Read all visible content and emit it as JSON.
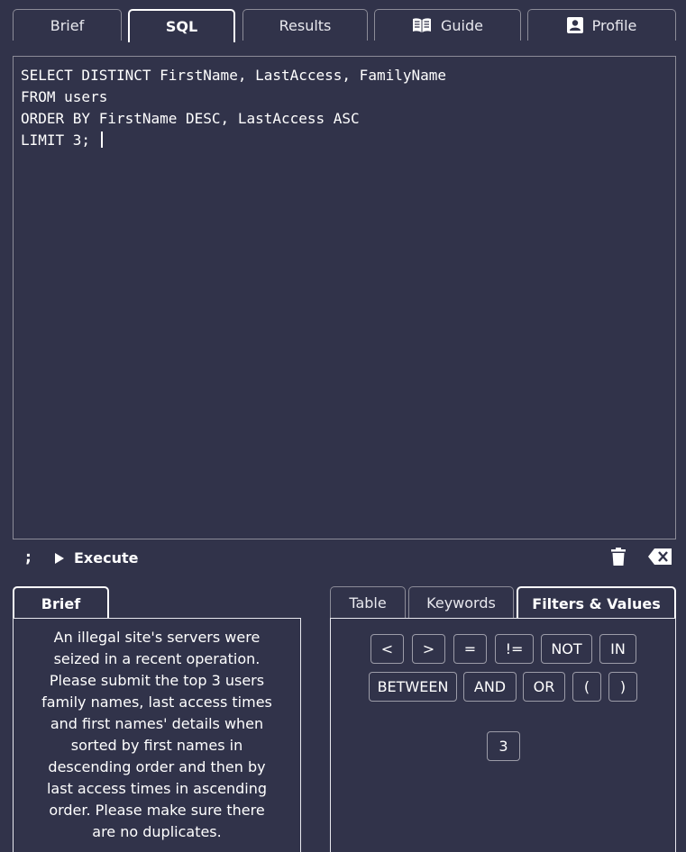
{
  "top_tabs": [
    {
      "label": "Brief",
      "active": false
    },
    {
      "label": "SQL",
      "active": true
    },
    {
      "label": "Results",
      "active": false
    },
    {
      "label": "Guide",
      "icon": "book-icon",
      "active": false
    },
    {
      "label": "Profile",
      "icon": "profile-icon",
      "active": false
    }
  ],
  "editor": {
    "lines": [
      "SELECT DISTINCT FirstName, LastAccess, FamilyName",
      "FROM users",
      "ORDER BY FirstName DESC, LastAccess ASC",
      "LIMIT 3; "
    ]
  },
  "toolbar": {
    "semicolon_label": ";",
    "execute_label": "Execute",
    "icons": [
      "play-icon",
      "trash-icon",
      "backspace-icon"
    ]
  },
  "left_panel": {
    "tab_label": "Brief",
    "brief_text": "An illegal site's servers were seized in a recent operation. Please submit the top 3 users family names, last access times and first names' details when sorted by first names in descending order and then by last access times in ascending order. Please make sure there are no duplicates."
  },
  "right_panel": {
    "tabs": [
      {
        "label": "Table",
        "active": false
      },
      {
        "label": "Keywords",
        "active": false
      },
      {
        "label": "Filters & Values",
        "active": true
      }
    ],
    "operators_row1": [
      "<",
      ">",
      "=",
      "!=",
      "NOT",
      "IN"
    ],
    "operators_row2": [
      "BETWEEN",
      "AND",
      "OR",
      "(",
      ")"
    ],
    "values": [
      "3"
    ]
  },
  "colors": {
    "background": "#31334a",
    "border": "#8c8c98",
    "text": "#ffffff"
  }
}
